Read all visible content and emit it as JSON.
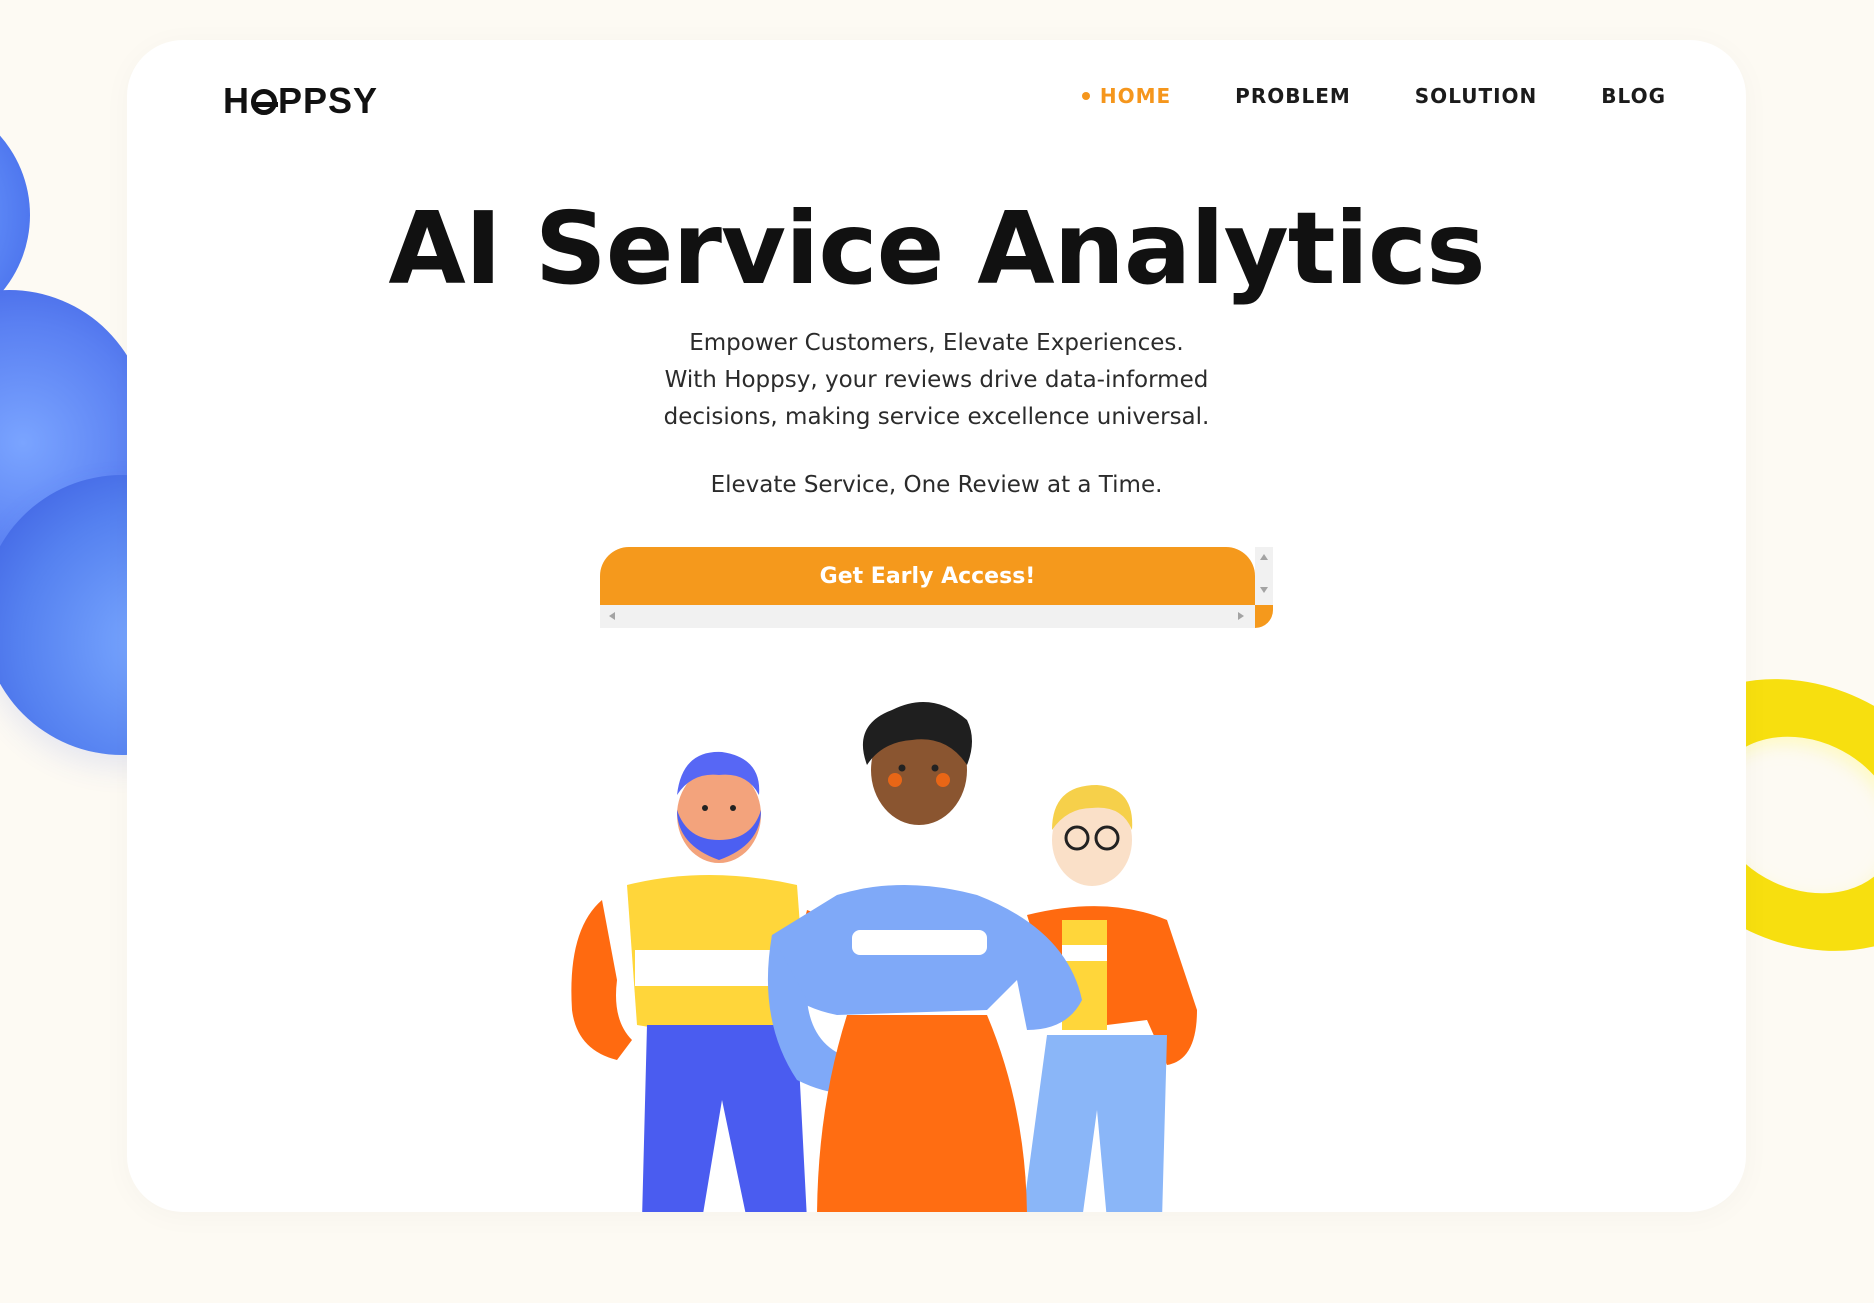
{
  "brand": {
    "logo_text": "HOPPSY",
    "accent": "#f5991c",
    "dark": "#111111"
  },
  "nav": {
    "items": [
      {
        "label": "HOME",
        "active": true
      },
      {
        "label": "PROBLEM",
        "active": false
      },
      {
        "label": "SOLUTION",
        "active": false
      },
      {
        "label": "BLOG",
        "active": false
      }
    ]
  },
  "hero": {
    "title": "AI Service Analytics",
    "subtitle_line1": "Empower Customers, Elevate Experiences.",
    "subtitle_line2": "With Hoppsy, your reviews drive data-informed",
    "subtitle_line3": "decisions, making service excellence universal.",
    "tagline": "Elevate Service, One Review at a Time.",
    "cta_label": "Get Early Access!"
  },
  "illustration": {
    "subject": "three-people-characters"
  },
  "decorations": {
    "left": "blue-spheres",
    "right": "yellow-torus"
  }
}
